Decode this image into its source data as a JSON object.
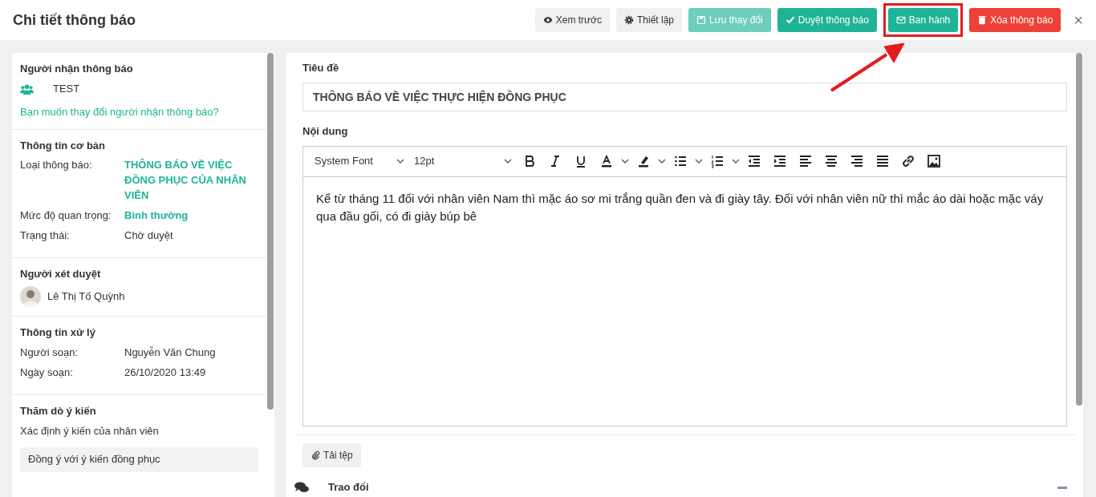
{
  "header": {
    "title": "Chi tiết thông báo",
    "buttons": [
      {
        "label": "Xem trước",
        "kind": "preview",
        "disabled": false,
        "annotated": false
      },
      {
        "label": "Thiết lập",
        "kind": "settings",
        "disabled": false,
        "annotated": false
      },
      {
        "label": "Lưu thay đổi",
        "kind": "save",
        "disabled": true,
        "annotated": false
      },
      {
        "label": "Duyệt thông báo",
        "kind": "approve",
        "disabled": false,
        "annotated": false
      },
      {
        "label": "Ban hành",
        "kind": "publish",
        "disabled": false,
        "annotated": true
      },
      {
        "label": "Xóa thông báo",
        "kind": "delete",
        "disabled": false,
        "annotated": false
      }
    ],
    "close": "×"
  },
  "sidebar": {
    "recipients": {
      "heading": "Người nhận thông báo",
      "group": "TEST",
      "change_link": "Bạn muốn thay đổi người nhận thông báo?"
    },
    "basic_info": {
      "heading": "Thông tin cơ bản",
      "rows": [
        {
          "label": "Loại thông báo:",
          "value": "THÔNG BÁO VỀ VIỆC ĐỒNG PHỤC CỦA NHÂN VIÊN",
          "emphasis": true
        },
        {
          "label": "Mức độ quan trọng:",
          "value": "Bình thường",
          "emphasis": true
        },
        {
          "label": "Trạng thái:",
          "value": "Chờ duyệt",
          "emphasis": false
        }
      ]
    },
    "reviewer": {
      "heading": "Người xét duyệt",
      "name": "Lê Thị Tố Quỳnh"
    },
    "processing": {
      "heading": "Thông tin xử lý",
      "rows": [
        {
          "label": "Người soạn:",
          "value": "Nguyễn Văn Chung",
          "emphasis": false
        },
        {
          "label": "Ngày soạn:",
          "value": "26/10/2020 13:49",
          "emphasis": false
        }
      ]
    },
    "survey": {
      "heading": "Thăm dò ý kiến",
      "question": "Xác định ý kiến của nhân viên",
      "options": [
        "Đồng ý với ý kiến đồng phục"
      ]
    }
  },
  "form": {
    "title_label": "Tiêu đề",
    "title_value": "THÔNG BÁO VỀ VIỆC THỰC HIỆN ĐỒNG PHỤC",
    "content_label": "Nội dung",
    "editor": {
      "font": "System Font",
      "size": "12pt",
      "body": "Kể từ tháng 11 đối với nhân viên Nam thì mặc áo sơ mi trắng quần đen và đi giày tây. Đối với nhân viên nữ thì mắc áo dài hoặc mặc váy qua đầu gối, có đi giày búp bê"
    },
    "attach_button": "Tải tệp",
    "discussion": {
      "heading": "Trao đổi",
      "expanded": true
    }
  }
}
